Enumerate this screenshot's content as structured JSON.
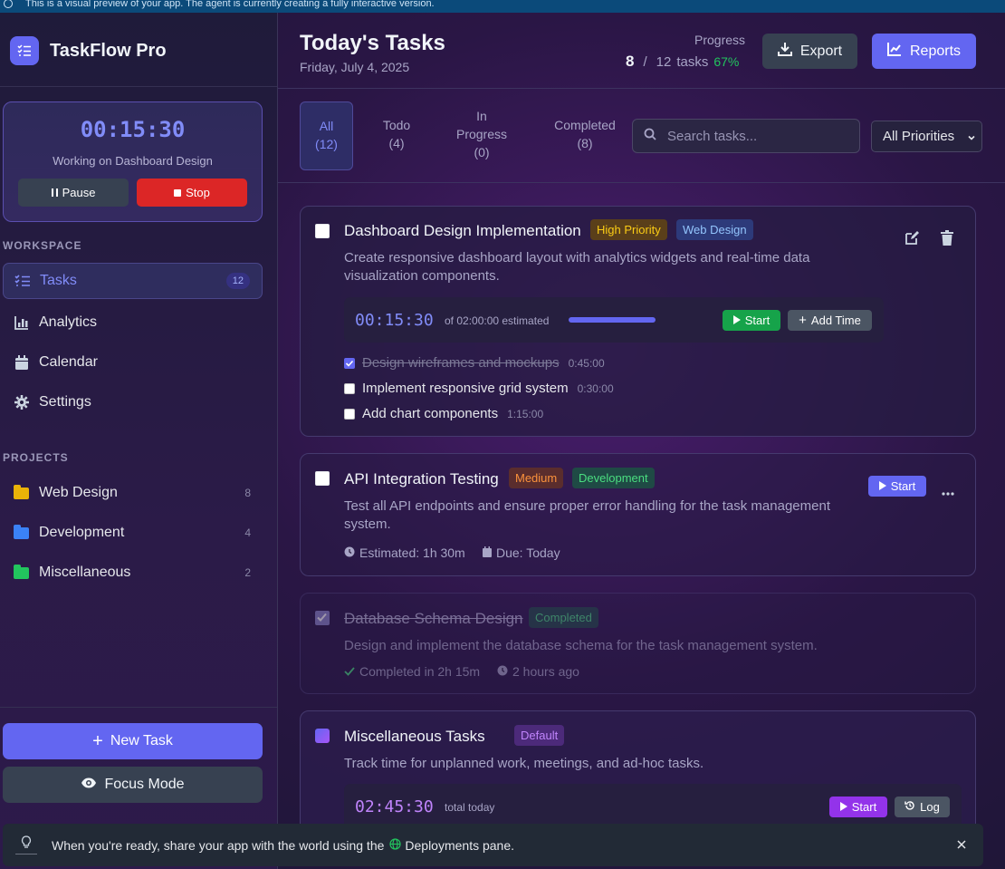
{
  "banner": {
    "text": "This is a visual preview of your app. The agent is currently creating a fully interactive version."
  },
  "app": {
    "name": "TaskFlow Pro"
  },
  "timer": {
    "time": "00:15:30",
    "working_on": "Working on Dashboard Design",
    "pause_label": "Pause",
    "stop_label": "Stop"
  },
  "workspace": {
    "label": "WORKSPACE",
    "items": [
      {
        "label": "Tasks",
        "count": "12",
        "icon": "tasks-icon"
      },
      {
        "label": "Analytics",
        "icon": "chart-icon"
      },
      {
        "label": "Calendar",
        "icon": "calendar-icon"
      },
      {
        "label": "Settings",
        "icon": "gear-icon"
      }
    ]
  },
  "projects": {
    "label": "PROJECTS",
    "items": [
      {
        "label": "Web Design",
        "count": "8",
        "color": "#eab308"
      },
      {
        "label": "Development",
        "count": "4",
        "color": "#3b82f6"
      },
      {
        "label": "Miscellaneous",
        "count": "2",
        "color": "#22c55e"
      }
    ]
  },
  "actions": {
    "new_task": "New Task",
    "focus_mode": "Focus Mode"
  },
  "header": {
    "title": "Today's Tasks",
    "date": "Friday, July 4, 2025",
    "progress_label": "Progress",
    "done": "8",
    "separator": "/",
    "total": "12",
    "unit": "tasks",
    "percent": "67%",
    "export_label": "Export",
    "reports_label": "Reports"
  },
  "filters": {
    "tabs": [
      {
        "line1": "All",
        "line2": "(12)"
      },
      {
        "line1": "Todo",
        "line2": "(4)"
      },
      {
        "line1": "In",
        "line2": "Progress",
        "line3": "(0)"
      },
      {
        "line1": "Completed",
        "line2": "(8)"
      }
    ],
    "search_placeholder": "Search tasks...",
    "priority_selected": "All Priorities"
  },
  "tasks": [
    {
      "title": "Dashboard Design Implementation",
      "badges": [
        "High Priority",
        "Web Design"
      ],
      "desc1": "Create responsive dashboard layout with analytics widgets and real-time data",
      "desc2": "visualization components.",
      "timer": "00:15:30",
      "estimate": "of 02:00:00 estimated",
      "progress": 0.13,
      "start_label": "Start",
      "add_time_label": "Add Time",
      "subtasks": [
        {
          "label": "Design wireframes and mockups",
          "duration": "0:45:00",
          "done": true
        },
        {
          "label": "Implement responsive grid system",
          "duration": "0:30:00",
          "done": false
        },
        {
          "label": "Add chart components",
          "duration": "1:15:00",
          "done": false
        }
      ]
    },
    {
      "title": "API Integration Testing",
      "badges": [
        "Medium",
        "Development"
      ],
      "desc1": "Test all API endpoints and ensure proper error handling for the task management",
      "desc2": "system.",
      "estimated": "Estimated: 1h 30m",
      "due": "Due: Today",
      "start_label": "Start"
    },
    {
      "title": "Database Schema Design",
      "badges": [
        "Completed"
      ],
      "desc1": "Design and implement the database schema for the task management system.",
      "completed_in": "Completed in 2h 15m",
      "ago": "2 hours ago"
    },
    {
      "title": "Miscellaneous Tasks",
      "badges": [
        "Default"
      ],
      "desc1": "Track time for unplanned work, meetings, and ad-hoc tasks.",
      "timer": "02:45:30",
      "total_label": "total today",
      "start_label": "Start",
      "log_label": "Log"
    }
  ],
  "toast": {
    "text_before": "When you're ready, share your app with the world using the",
    "text_after": "Deployments pane."
  }
}
